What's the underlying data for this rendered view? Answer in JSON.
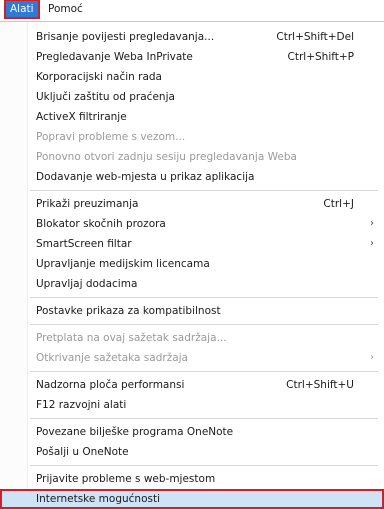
{
  "menubar": {
    "items": [
      {
        "label": "Alati",
        "active": true
      },
      {
        "label": "Pomoć",
        "active": false
      }
    ]
  },
  "menu": {
    "items": [
      {
        "label": "Brisanje povijesti pregledavanja...",
        "shortcut": "Ctrl+Shift+Del",
        "enabled": true
      },
      {
        "label": "Pregledavanje Weba InPrivate",
        "shortcut": "Ctrl+Shift+P",
        "enabled": true
      },
      {
        "label": "Korporacijski način rada",
        "enabled": true
      },
      {
        "label": "Uključi zaštitu od praćenja",
        "enabled": true
      },
      {
        "label": "ActiveX filtriranje",
        "enabled": true
      },
      {
        "label": "Popravi probleme s vezom...",
        "enabled": false
      },
      {
        "label": "Ponovno otvori zadnju sesiju pregledavanja Weba",
        "enabled": false
      },
      {
        "label": "Dodavanje web-mjesta u prikaz aplikacija",
        "enabled": true
      },
      {
        "label": "Prikaži preuzimanja",
        "shortcut": "Ctrl+J",
        "enabled": true
      },
      {
        "label": "Blokator skočnih prozora",
        "submenu": true,
        "enabled": true
      },
      {
        "label": "SmartScreen filtar",
        "submenu": true,
        "enabled": true
      },
      {
        "label": "Upravljanje medijskim licencama",
        "enabled": true
      },
      {
        "label": "Upravljaj dodacima",
        "enabled": true
      },
      {
        "label": "Postavke prikaza za kompatibilnost",
        "enabled": true
      },
      {
        "label": "Pretplata na ovaj sažetak sadržaja...",
        "enabled": false
      },
      {
        "label": "Otkrivanje sažetaka sadržaja",
        "submenu": true,
        "enabled": false
      },
      {
        "label": "Nadzorna ploča performansi",
        "shortcut": "Ctrl+Shift+U",
        "enabled": true
      },
      {
        "label": "F12 razvojni alati",
        "enabled": true
      },
      {
        "label": "Povezane bilješke programa OneNote",
        "enabled": true
      },
      {
        "label": "Pošalji u OneNote",
        "enabled": true
      },
      {
        "label": "Prijavite probleme s web-mjestom",
        "enabled": true
      },
      {
        "label": "Internetske mogućnosti",
        "enabled": true,
        "highlighted": true
      }
    ]
  },
  "icons": {
    "submenu_arrow": "chevron-right-icon"
  },
  "colors": {
    "active_menubar_bg": "#2f7ad3",
    "highlight_outline": "#c8232c",
    "hover_bg": "#cfe3f7",
    "disabled_text": "#9a9a9a"
  }
}
